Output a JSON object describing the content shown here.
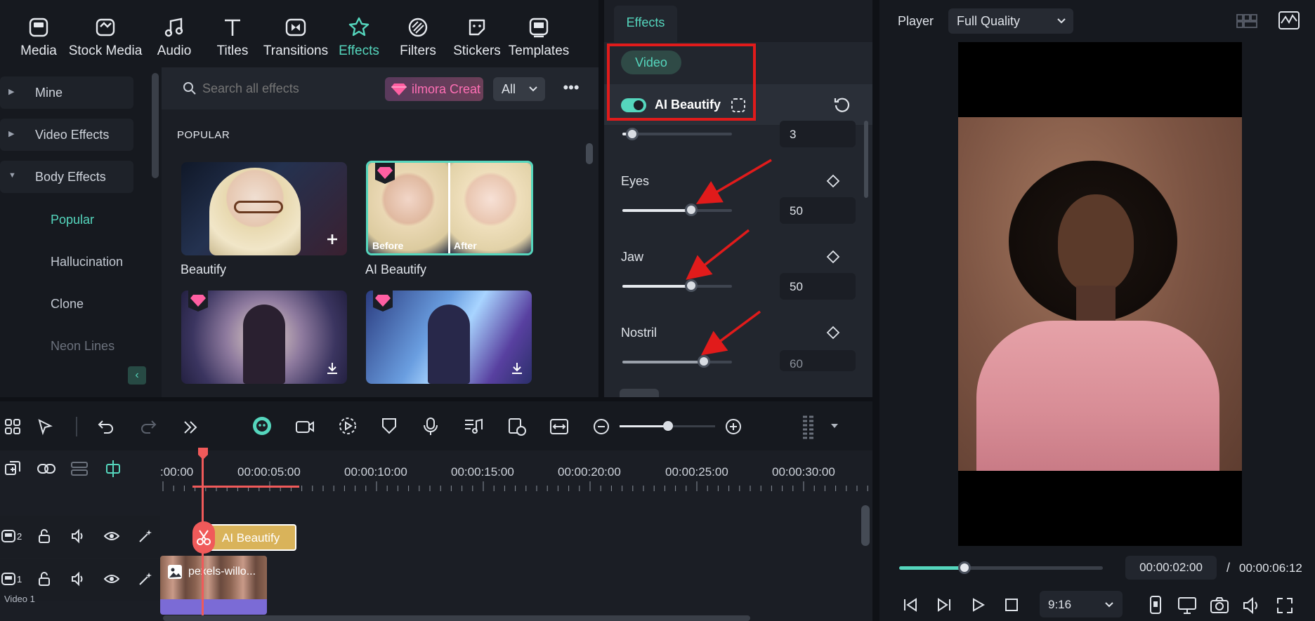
{
  "tabs": [
    {
      "label": "Media",
      "icon": "media-icon"
    },
    {
      "label": "Stock Media",
      "icon": "stock-media-icon"
    },
    {
      "label": "Audio",
      "icon": "audio-icon"
    },
    {
      "label": "Titles",
      "icon": "titles-icon"
    },
    {
      "label": "Transitions",
      "icon": "transitions-icon"
    },
    {
      "label": "Effects",
      "icon": "effects-icon",
      "active": true
    },
    {
      "label": "Filters",
      "icon": "filters-icon"
    },
    {
      "label": "Stickers",
      "icon": "stickers-icon"
    },
    {
      "label": "Templates",
      "icon": "templates-icon"
    }
  ],
  "sidebar": {
    "categories": [
      {
        "label": "Mine"
      },
      {
        "label": "Video Effects"
      },
      {
        "label": "Body Effects",
        "expanded": true
      }
    ],
    "subitems": [
      {
        "label": "Popular",
        "active": true
      },
      {
        "label": "Hallucination"
      },
      {
        "label": "Clone"
      },
      {
        "label": "Neon Lines"
      }
    ]
  },
  "browser": {
    "search_placeholder": "Search all effects",
    "promo_label": "ilmora Creat",
    "filter_value": "All",
    "section_title": "POPULAR",
    "items": [
      {
        "label": "Beautify"
      },
      {
        "label": "AI Beautify",
        "before_label": "Before",
        "after_label": "After"
      },
      {
        "label": ""
      },
      {
        "label": ""
      }
    ]
  },
  "props": {
    "panel_tab": "Effects",
    "section_tab": "Video",
    "effect_name": "AI Beautify",
    "effect_enabled": true,
    "sliders": [
      {
        "label": "",
        "value": "3",
        "fraction": 0.07
      },
      {
        "label": "Eyes",
        "value": "50",
        "fraction": 0.5
      },
      {
        "label": "Jaw",
        "value": "50",
        "fraction": 0.5
      },
      {
        "label": "Nostril",
        "value": "60",
        "fraction": 0.6
      }
    ],
    "accent": "#55d6bd",
    "highlight_color": "#e11b1b"
  },
  "player": {
    "title": "Player",
    "quality": "Full Quality",
    "current_time": "00:00:02:00",
    "separator": "/",
    "total_time": "00:00:06:12",
    "aspect": "9:16",
    "progress": 0.32
  },
  "timeline": {
    "timecodes": [
      ":00:00",
      "00:00:05:00",
      "00:00:10:00",
      "00:00:15:00",
      "00:00:20:00",
      "00:00:25:00",
      "00:00:30:00"
    ],
    "tracks": [
      {
        "number": "2",
        "clip": "AI Beautify"
      },
      {
        "number": "1",
        "clip": "pexels-willo...",
        "name": "Video 1"
      }
    ],
    "playhead_color": "#f05a5a",
    "effect_clip_color": "#d9b35a"
  }
}
